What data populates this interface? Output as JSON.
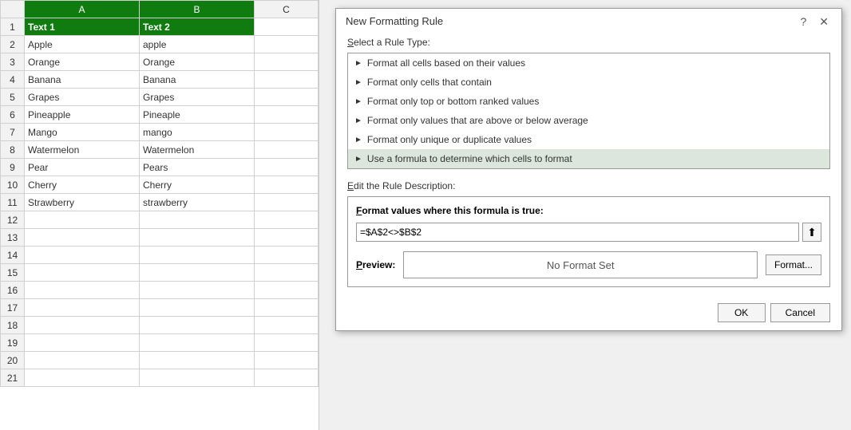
{
  "spreadsheet": {
    "col_headers": [
      "",
      "A",
      "B",
      "C"
    ],
    "rows": [
      {
        "num": "1",
        "a": "Text 1",
        "b": "Text 2",
        "c": "",
        "header": true
      },
      {
        "num": "2",
        "a": "Apple",
        "b": "apple",
        "c": ""
      },
      {
        "num": "3",
        "a": "Orange",
        "b": "Orange",
        "c": ""
      },
      {
        "num": "4",
        "a": "Banana",
        "b": "Banana",
        "c": ""
      },
      {
        "num": "5",
        "a": "Grapes",
        "b": "Grapes",
        "c": ""
      },
      {
        "num": "6",
        "a": "Pineapple",
        "b": "Pineaple",
        "c": ""
      },
      {
        "num": "7",
        "a": "Mango",
        "b": "mango",
        "c": ""
      },
      {
        "num": "8",
        "a": "Watermelon",
        "b": "Watermelon",
        "c": ""
      },
      {
        "num": "9",
        "a": "Pear",
        "b": "Pears",
        "c": ""
      },
      {
        "num": "10",
        "a": "Cherry",
        "b": "Cherry",
        "c": ""
      },
      {
        "num": "11",
        "a": "Strawberry",
        "b": "strawberry",
        "c": ""
      },
      {
        "num": "12",
        "a": "",
        "b": "",
        "c": ""
      },
      {
        "num": "13",
        "a": "",
        "b": "",
        "c": ""
      },
      {
        "num": "14",
        "a": "",
        "b": "",
        "c": ""
      },
      {
        "num": "15",
        "a": "",
        "b": "",
        "c": ""
      },
      {
        "num": "16",
        "a": "",
        "b": "",
        "c": ""
      },
      {
        "num": "17",
        "a": "",
        "b": "",
        "c": ""
      },
      {
        "num": "18",
        "a": "",
        "b": "",
        "c": ""
      },
      {
        "num": "19",
        "a": "",
        "b": "",
        "c": ""
      },
      {
        "num": "20",
        "a": "",
        "b": "",
        "c": ""
      },
      {
        "num": "21",
        "a": "",
        "b": "",
        "c": ""
      }
    ]
  },
  "dialog": {
    "title": "New Formatting Rule",
    "select_rule_label": "Select a Rule Type:",
    "rule_types": [
      {
        "label": "Format all cells based on their values"
      },
      {
        "label": "Format only cells that contain"
      },
      {
        "label": "Format only top or bottom ranked values"
      },
      {
        "label": "Format only values that are above or below average"
      },
      {
        "label": "Format only unique or duplicate values"
      },
      {
        "label": "Use a formula to determine which cells to format"
      }
    ],
    "edit_rule_label": "Edit the Rule Description:",
    "formula_section_title": "Format values where this formula is true:",
    "formula_value": "=$A$2<>$B$2",
    "preview_label": "Preview:",
    "no_format_text": "No Format Set",
    "format_button": "Format...",
    "ok_button": "OK",
    "cancel_button": "Cancel",
    "help_icon": "?",
    "close_icon": "✕"
  }
}
